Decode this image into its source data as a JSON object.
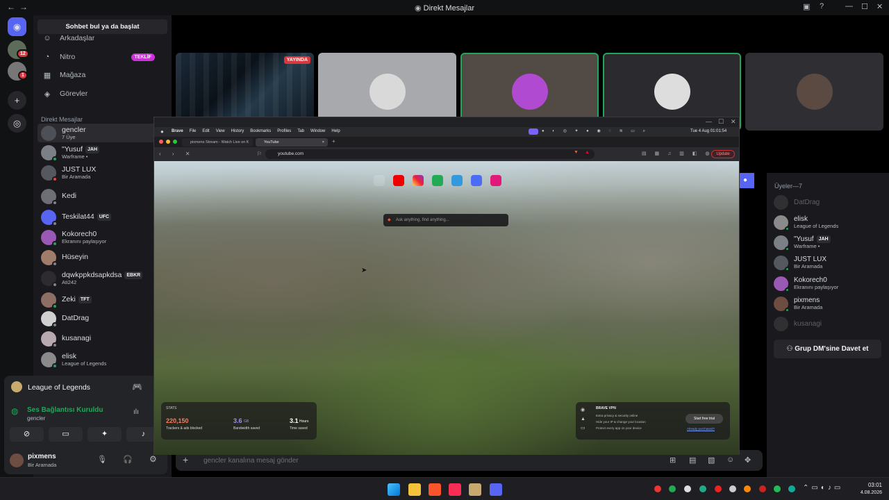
{
  "window": {
    "title": "Direkt Mesajlar"
  },
  "rail": {
    "badges": [
      "12",
      "1"
    ]
  },
  "sidebar": {
    "search_label": "Sohbet bul ya da başlat",
    "nav": [
      {
        "label": "Arkadaşlar"
      },
      {
        "label": "Nitro",
        "badge": "TEKLİF"
      },
      {
        "label": "Mağaza"
      },
      {
        "label": "Görevler"
      }
    ],
    "section_title": "Direkt Mesajlar",
    "dms": [
      {
        "name": "gencler",
        "sub": "7 Üye",
        "color": "#4e5058",
        "status": ""
      },
      {
        "name": "\"Yusuf",
        "tag": "JAH",
        "sub": "Warframe •",
        "color": "#7b7f86",
        "status": "#23a55a"
      },
      {
        "name": "JUST LUX",
        "sub": "Bir Aramada",
        "color": "#55595f",
        "status": "#f23f43"
      },
      {
        "name": "Kedi",
        "sub": "",
        "color": "#6d6f74",
        "status": "#80848e"
      },
      {
        "name": "Teskilat44",
        "tag": "UFC",
        "sub": "",
        "color": "#5865f2",
        "status": "#80848e"
      },
      {
        "name": "Kokorech0",
        "sub": "Ekranını paylaşıyor",
        "color": "#9b59b6",
        "status": "#23a55a"
      },
      {
        "name": "Hüseyin",
        "sub": "",
        "color": "#a07c6b",
        "status": "#80848e"
      },
      {
        "name": "dqwkppkdsapkdsa",
        "tag": "EBKR",
        "sub": "Ati242",
        "color": "#2d2b30",
        "status": "#80848e"
      },
      {
        "name": "Zeki",
        "tag": "TFT",
        "sub": "",
        "color": "#8d6e63",
        "status": "#23a55a"
      },
      {
        "name": "DatDrag",
        "sub": "",
        "color": "#d0d0d0",
        "status": "#80848e"
      },
      {
        "name": "kusanagi",
        "sub": "",
        "color": "#b8a8b0",
        "status": "#80848e"
      },
      {
        "name": "elisk",
        "sub": "League of Legends",
        "color": "#8a8a8a",
        "status": "#23a55a"
      }
    ]
  },
  "voice": {
    "game": "League of Legends",
    "status": "Ses Bağlantısı Kuruldu",
    "channel": "gencler",
    "user_name": "pixmens",
    "user_status": "Bir Aramada"
  },
  "stream": {
    "live_label": "YAYINDA"
  },
  "browser": {
    "menu": [
      "Brave",
      "File",
      "Edit",
      "View",
      "History",
      "Bookmarks",
      "Profiles",
      "Tab",
      "Window",
      "Help"
    ],
    "clock": "Tue 4 Aug 01:01:54",
    "tabs": [
      "pixmens Stream - Watch Live on K",
      "YouTube"
    ],
    "url": "youtube.com",
    "update_label": "Update",
    "search_placeholder": "Ask anything, find anything...",
    "stats": {
      "title": "STATS",
      "trackers": "220,150",
      "trackers_label": "Trackers & ads blocked",
      "bandwidth": "3.6",
      "bandwidth_unit": "GB",
      "bandwidth_label": "Bandwidth saved",
      "time": "3.1",
      "time_unit": "Hours",
      "time_label": "Time saved"
    },
    "vpn": {
      "title": "BRAVE VPN",
      "lines": [
        "Extra privacy & security online",
        "Hide your IP & change your location",
        "Protect every app on your device"
      ],
      "cta": "Start free trial",
      "link": "Already purchased?"
    }
  },
  "members": {
    "header": "Üyeler—7",
    "list": [
      {
        "name": "DatDrag",
        "sub": "",
        "dim": true,
        "color": "#5a5a5a"
      },
      {
        "name": "elisk",
        "sub": "League of Legends",
        "dim": false,
        "color": "#8a8a8a"
      },
      {
        "name": "\"Yusuf",
        "tag": "JAH",
        "sub": "Warframe •",
        "dim": false,
        "color": "#7b7f86"
      },
      {
        "name": "JUST LUX",
        "sub": "Bir Aramada",
        "dim": false,
        "color": "#55595f"
      },
      {
        "name": "Kokorech0",
        "sub": "Ekranını paylaşıyor",
        "dim": false,
        "color": "#9b59b6"
      },
      {
        "name": "pixmens",
        "sub": "Bir Aramada",
        "dim": false,
        "color": "#6d4c41"
      },
      {
        "name": "kusanagi",
        "sub": "",
        "dim": true,
        "color": "#5a5a5a"
      }
    ],
    "invite_label": "Grup DM'sine Davet et"
  },
  "chat": {
    "placeholder": "gencler kanalına mesaj gönder"
  },
  "taskbar": {
    "time": "03:01",
    "date": "4.08.2026"
  }
}
